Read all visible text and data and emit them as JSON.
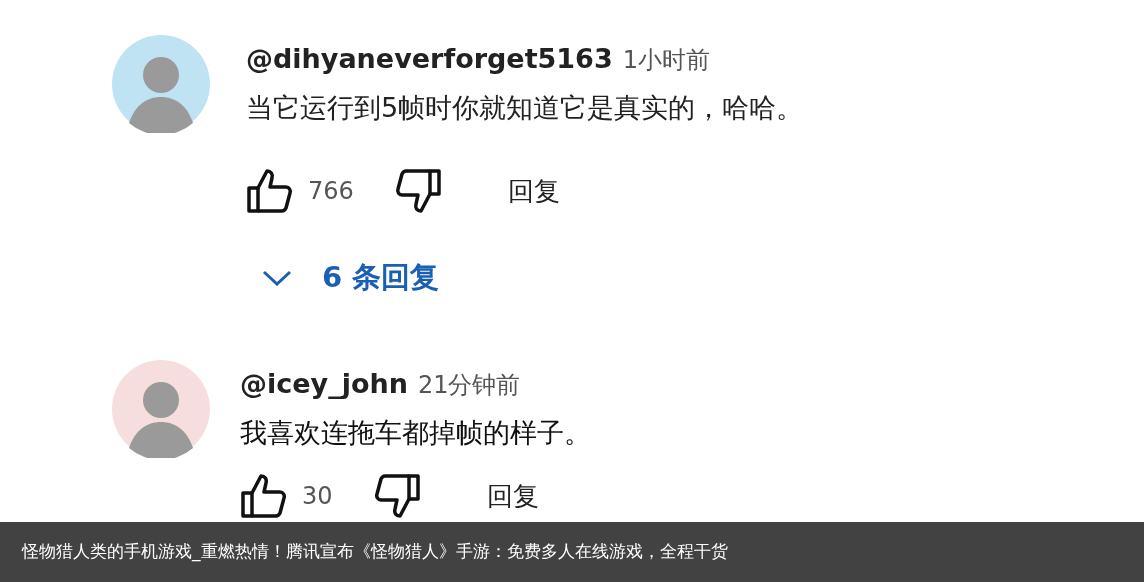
{
  "comments": [
    {
      "author": "@dihyaneverforget5163",
      "time": "1小时前",
      "text": "当它运行到5帧时你就知道它是真实的，哈哈。",
      "likes": "766",
      "reply_label": "回复",
      "replies_toggle": {
        "count": "6",
        "label": "条回复"
      }
    },
    {
      "author": "@icey_john",
      "time": "21分钟前",
      "text": "我喜欢连拖车都掉帧的样子。",
      "likes": "30",
      "reply_label": "回复"
    }
  ],
  "caption": "怪物猎人类的手机游戏_重燃热情！腾讯宣布《怪物猎人》手游：免费多人在线游戏，全程干货"
}
